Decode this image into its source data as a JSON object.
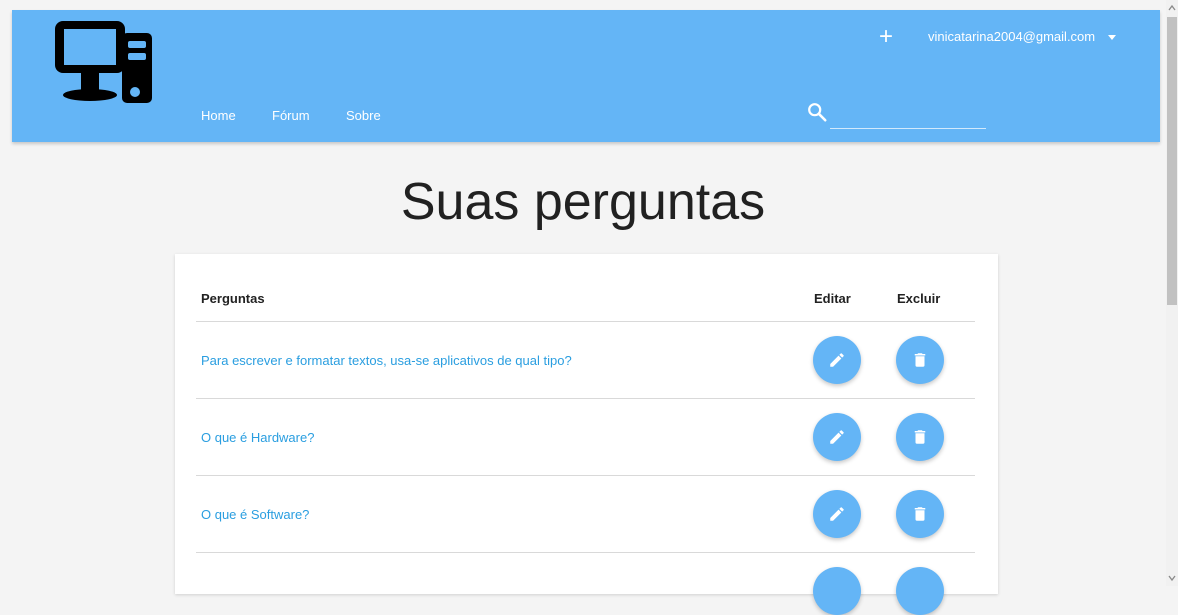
{
  "navbar": {
    "logo_icon": "desktop-computer-icon",
    "links": [
      {
        "label": "Home"
      },
      {
        "label": "Fórum"
      },
      {
        "label": "Sobre"
      }
    ],
    "add_icon": "+",
    "user_email": "vinicatarina2004@gmail.com",
    "search": {
      "placeholder": "",
      "value": "",
      "icon": "search-icon"
    },
    "color": "#64b5f6"
  },
  "main": {
    "title": "Suas perguntas",
    "table": {
      "headers": {
        "question": "Perguntas",
        "edit": "Editar",
        "delete": "Excluir"
      },
      "rows": [
        {
          "question": "Para escrever e formatar textos, usa-se aplicativos de qual tipo?"
        },
        {
          "question": "O que é Hardware?"
        },
        {
          "question": "O que é Software?"
        }
      ],
      "edit_icon": "pencil-icon",
      "delete_icon": "trash-icon",
      "link_color": "#2a9ee0"
    }
  }
}
